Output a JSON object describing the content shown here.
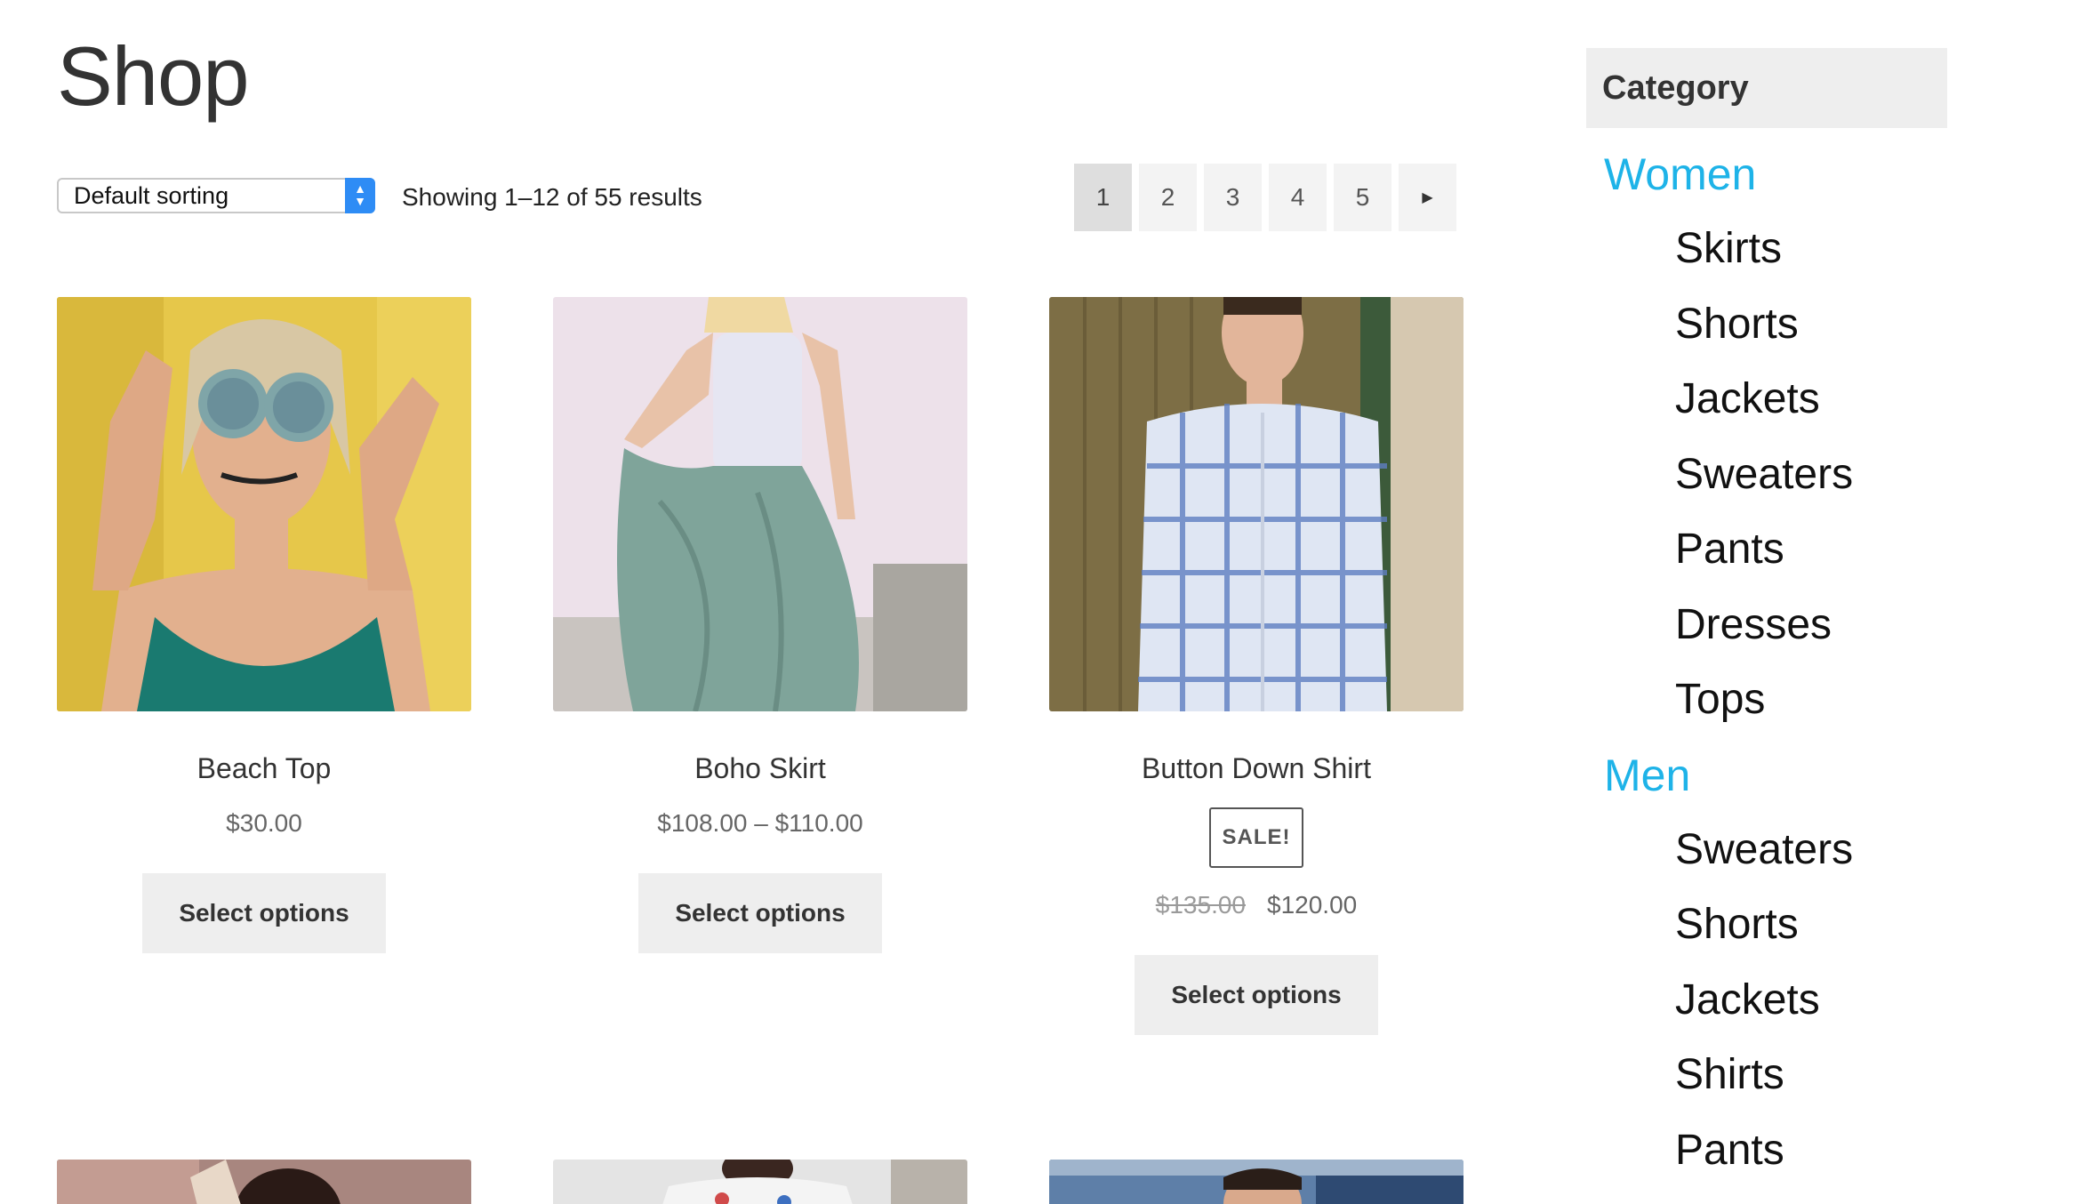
{
  "page": {
    "title": "Shop"
  },
  "toolbar": {
    "sort_selected": "Default sorting",
    "result_count": "Showing 1–12 of 55 results",
    "pagination": [
      "1",
      "2",
      "3",
      "4",
      "5"
    ],
    "current_page": "1"
  },
  "products": [
    {
      "name": "Beach Top",
      "price": "$30.00",
      "button": "Select options"
    },
    {
      "name": "Boho Skirt",
      "price": "$108.00 – $110.00",
      "button": "Select options"
    },
    {
      "name": "Button Down Shirt",
      "sale_badge": "SALE!",
      "old_price": "$135.00",
      "price": "$120.00",
      "button": "Select options"
    }
  ],
  "sidebar": {
    "title": "Category",
    "groups": [
      {
        "label": "Women",
        "items": [
          "Skirts",
          "Shorts",
          "Jackets",
          "Sweaters",
          "Pants",
          "Dresses",
          "Tops"
        ]
      },
      {
        "label": "Men",
        "items": [
          "Sweaters",
          "Shorts",
          "Jackets",
          "Shirts",
          "Pants"
        ]
      }
    ]
  },
  "colors": {
    "accent": "#1eb3e8",
    "button_bg": "#eeeeee",
    "select_accent": "#2e8cf5"
  }
}
